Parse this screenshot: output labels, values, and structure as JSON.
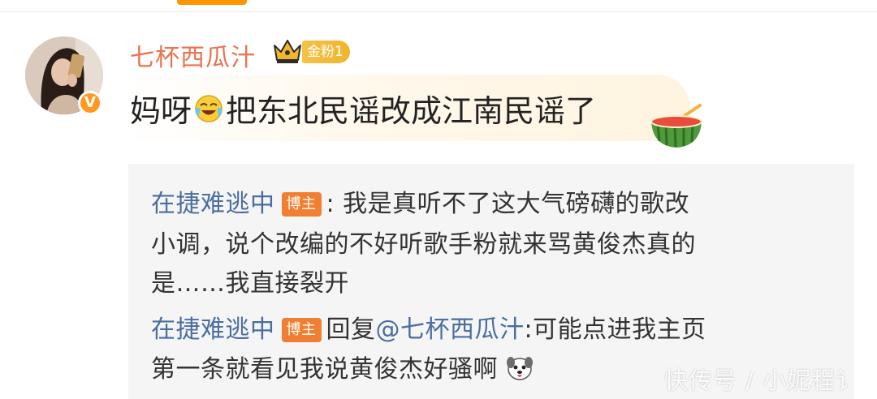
{
  "post": {
    "username": "七杯西瓜汁",
    "fan_badge": "金粉1",
    "text_before_emoji": "妈呀",
    "text_after_emoji": "把东北民谣改成江南民谣了"
  },
  "replies": [
    {
      "user": "在捷难逃中",
      "tag": "博主",
      "lines": [
        ": 我是真听不了这大气磅礴的歌改",
        "小调，说个改编的不好听歌手粉就来骂黄俊杰真的",
        "是……我直接裂开"
      ]
    },
    {
      "user": "在捷难逃中",
      "tag": "博主",
      "reply_prefix": "回复",
      "mention": "@七杯西瓜汁",
      "line1_rest": ":可能点进我主页",
      "line2": "第一条就看见我说黄俊杰好骚啊"
    }
  ],
  "watermark": "快传号 / 小妮程讠",
  "colors": {
    "username": "#eb7350",
    "link": "#4a6e9f",
    "blogger_tag": "#f07f33",
    "panel": "#f5f5f5"
  },
  "icons": [
    "crown-icon",
    "verified-icon",
    "laugh-cry-emoji",
    "watermelon-icon",
    "dog-emoji"
  ]
}
